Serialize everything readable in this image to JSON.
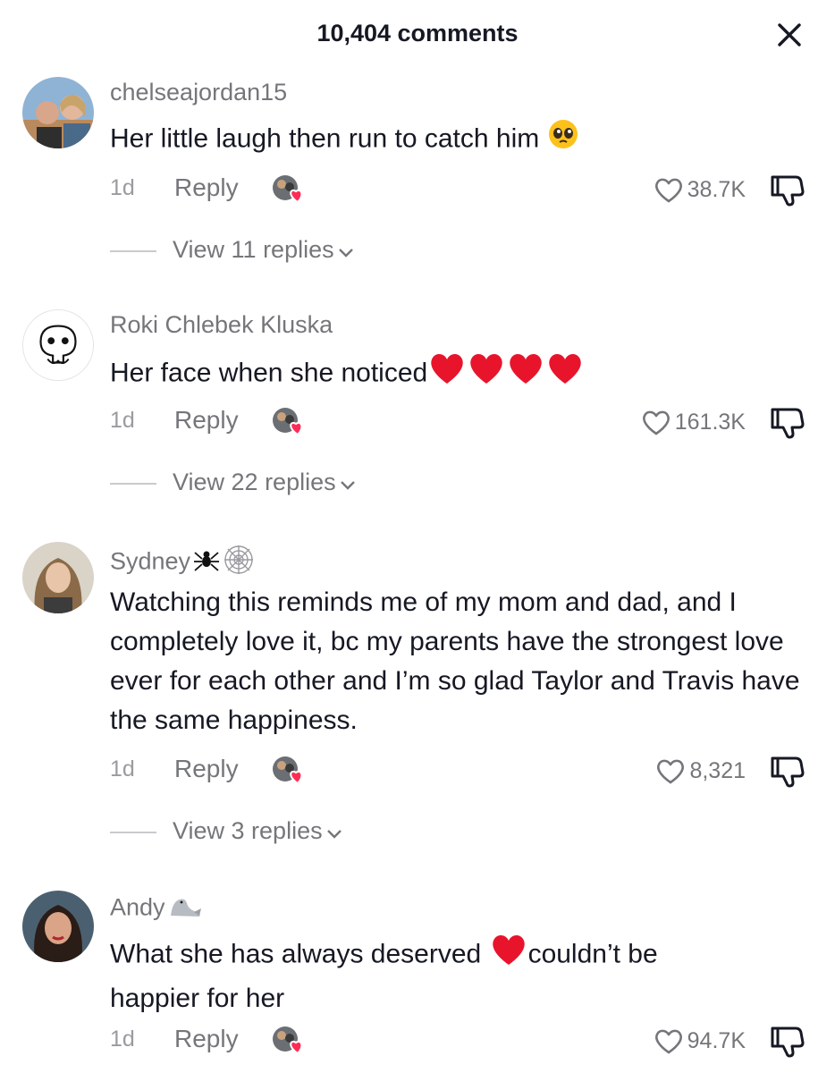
{
  "header": {
    "title": "10,404 comments"
  },
  "comments": [
    {
      "username": "chelseajordan15",
      "text": "Her little laugh then run to catch him",
      "age": "1d",
      "reply_label": "Reply",
      "likes": "38.7K",
      "view_replies": "View 11 replies",
      "emoji": [
        "pleading-face"
      ]
    },
    {
      "username": "Roki Chlebek Kluska",
      "text": "Her face when she noticed",
      "age": "1d",
      "reply_label": "Reply",
      "likes": "161.3K",
      "view_replies": "View 22 replies",
      "emoji": [
        "red-heart",
        "red-heart",
        "red-heart",
        "red-heart"
      ]
    },
    {
      "username": "Sydney",
      "text": "Watching this reminds me of my mom and dad, and I completely love it, bc my parents have the strongest love ever for each other and I’m so glad Taylor and Travis have the same happiness.",
      "age": "1d",
      "reply_label": "Reply",
      "likes": "8,321",
      "view_replies": "View 3 replies",
      "name_emoji": [
        "spider",
        "spider-web"
      ]
    },
    {
      "username": "Andy",
      "text_part1": "What she has always deserved",
      "text_part2": "couldn’t be happier for her",
      "age": "1d",
      "reply_label": "Reply",
      "likes": "94.7K",
      "name_emoji": [
        "seal"
      ],
      "emoji": [
        "red-heart"
      ]
    }
  ],
  "colors": {
    "text": "#161823",
    "secondary": "#75767a",
    "heart": "#e8142c"
  }
}
